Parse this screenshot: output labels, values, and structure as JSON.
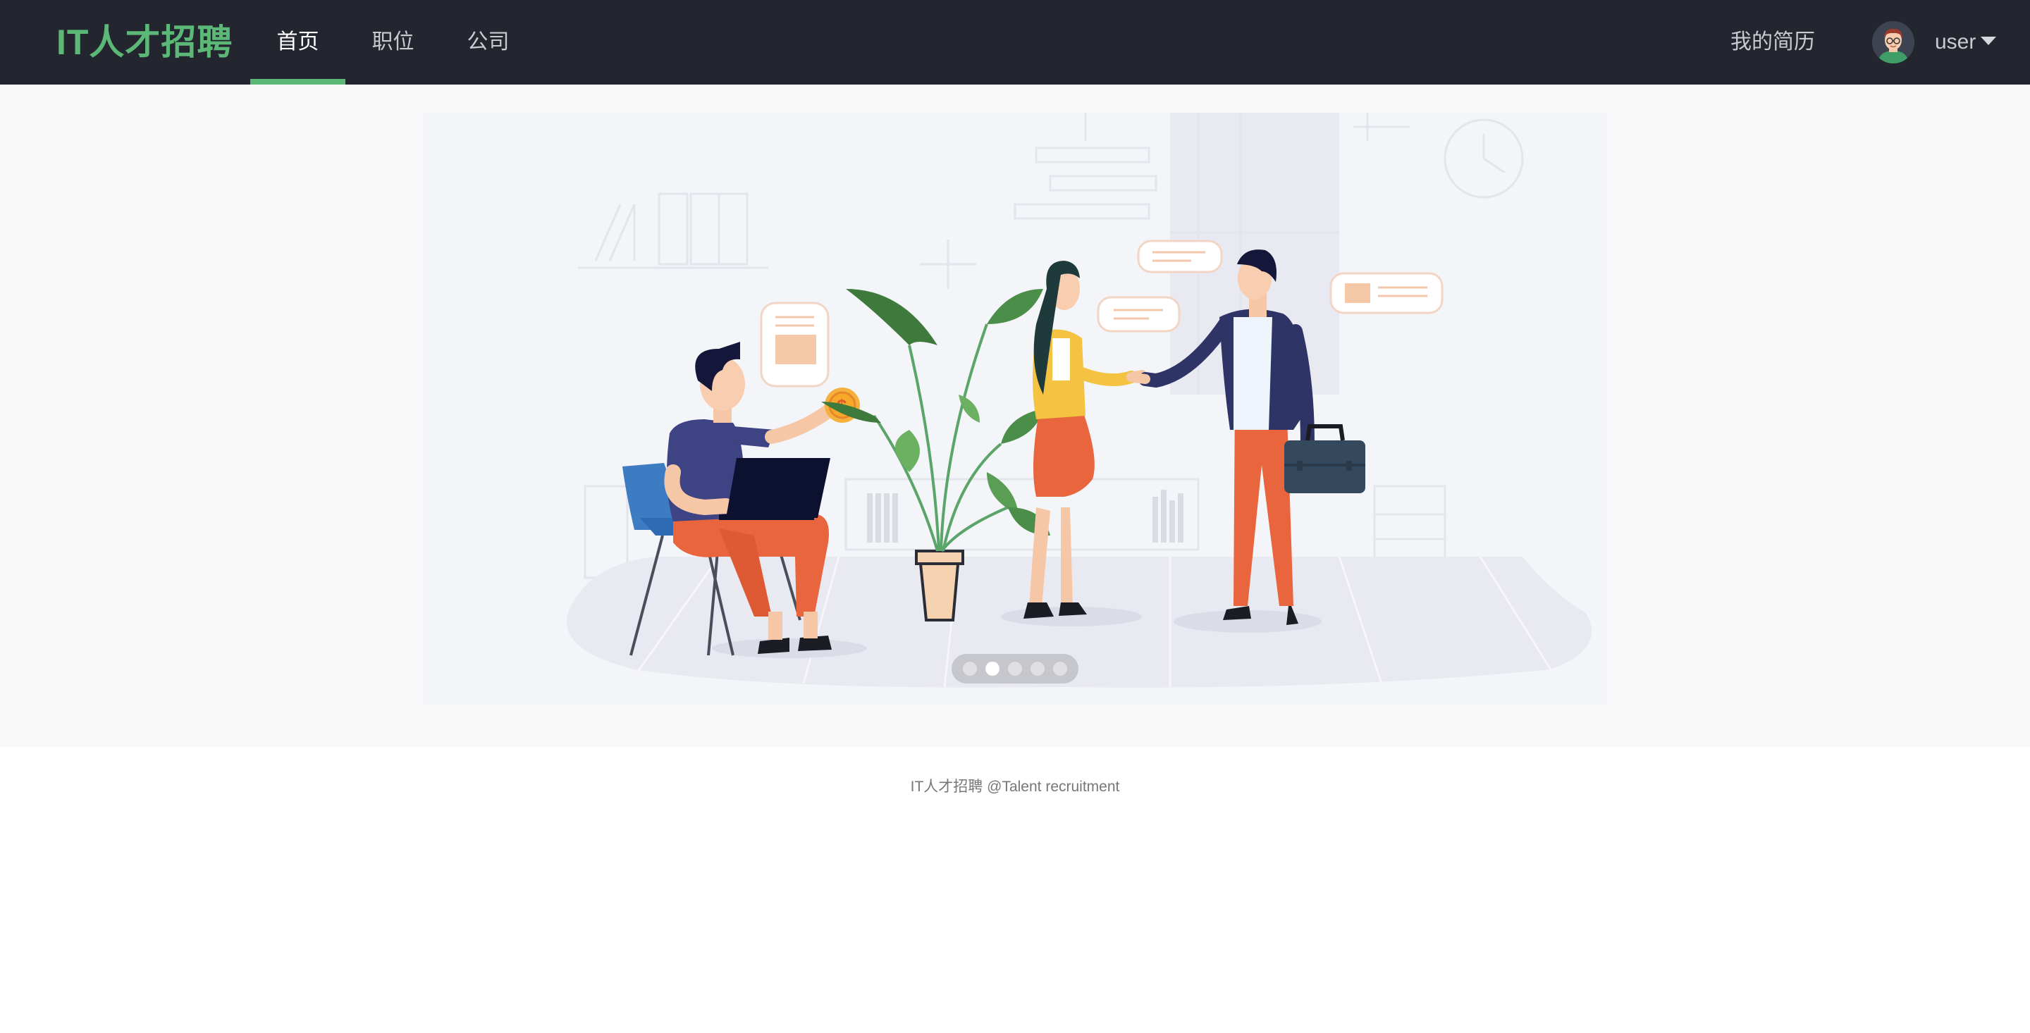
{
  "header": {
    "logo": "IT人才招聘",
    "nav": [
      {
        "label": "首页",
        "active": true
      },
      {
        "label": "职位",
        "active": false
      },
      {
        "label": "公司",
        "active": false
      }
    ],
    "resume_link": "我的简历",
    "user_name": "user",
    "avatar_icon": "user-avatar-icon",
    "dropdown_icon": "caret-down-icon"
  },
  "carousel": {
    "slide_count": 5,
    "active_index": 1,
    "illustration": "handshake-recruitment-illustration"
  },
  "footer": {
    "text": "IT人才招聘 @Talent recruitment"
  },
  "colors": {
    "header_bg": "#24262f",
    "accent": "#5cb877",
    "banner_bg": "#f8f8f8"
  }
}
